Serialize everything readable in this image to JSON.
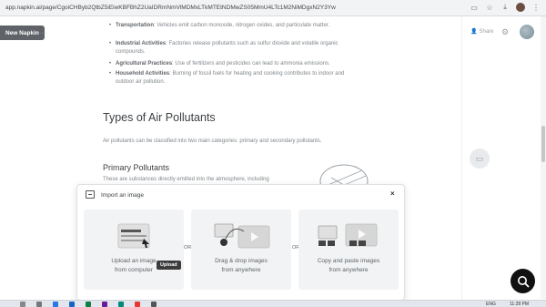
{
  "browser": {
    "url": "app.napkin.ai/page/CgoiCHByb2QtbZ5iEiwKBFBhZ2UaIDRmNmVlMDMxLTkMTEtNDMwZS05MmU4LTc1M2NiMDgxN2Y3Yw",
    "icons": [
      "install-icon",
      "star-icon",
      "download-icon",
      "profile-avatar",
      "menu-icon"
    ]
  },
  "app": {
    "new_button": "New Napkin",
    "share_label": "Share"
  },
  "doc": {
    "bullets": [
      {
        "term": "Transportation",
        "text": ": Vehicles emit carbon monoxide, nitrogen oxides, and particulate matter."
      },
      {
        "term": "Industrial Activities",
        "text": ": Factories release pollutants such as sulfur dioxide and volatile organic compounds."
      },
      {
        "term": "Agricultural Practices",
        "text": ": Use of fertilizers and pesticides can lead to ammonia emissions."
      },
      {
        "term": "Household Activities",
        "text": ": Burning of fossil fuels for heating and cooking contributes to indoor and outdoor air pollution."
      }
    ],
    "heading": "Types of Air Pollutants",
    "paragraph": "Air pollutants can be classified into two main categories: primary and secondary pollutants.",
    "subheading": "Primary Pollutants",
    "paragraph2": "These are substances directly emitted into the atmosphere, including"
  },
  "dialog": {
    "title": "Import an image",
    "close": "×",
    "options": [
      {
        "line1": "Upload an image",
        "line2": "from computer"
      },
      {
        "line1": "Drag & drop images",
        "line2": "from anywhere"
      },
      {
        "line1": "Copy and paste images",
        "line2": "from anywhere"
      }
    ],
    "or": "OR",
    "upload_tip": "Upload"
  },
  "taskbar": {
    "lang": "ENG",
    "time": "11:28 PM"
  },
  "colors": {
    "fab": "#111111",
    "new_button_bg": "#5f6368",
    "option_bg": "#f1f3f4"
  }
}
